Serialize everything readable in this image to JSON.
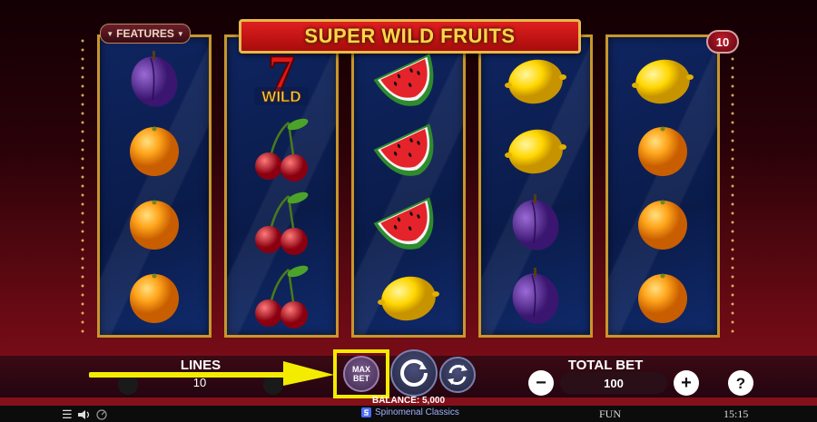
{
  "game": {
    "title": "SUPER WILD FRUITS",
    "features_label": "FEATURES",
    "lines_badge": "10"
  },
  "reels": [
    [
      "plum",
      "orange",
      "orange",
      "orange"
    ],
    [
      "wild-seven",
      "cherries",
      "cherries",
      "cherries"
    ],
    [
      "watermelon",
      "watermelon",
      "watermelon",
      "lemon"
    ],
    [
      "lemon",
      "lemon",
      "plum",
      "plum"
    ],
    [
      "lemon",
      "orange",
      "orange",
      "orange"
    ]
  ],
  "wild_text": "WILD",
  "controls": {
    "lines_label": "LINES",
    "lines_value": "10",
    "max_bet_line1": "MAX",
    "max_bet_line2": "BET",
    "total_bet_label": "TOTAL BET",
    "total_bet_value": "100",
    "minus": "−",
    "plus": "+",
    "help": "?",
    "balance": "BALANCE: 5,000"
  },
  "status_bar": {
    "brand": "Spinomenal Classics",
    "mode": "FUN",
    "clock": "15:15"
  },
  "colors": {
    "highlight": "#f4ec00",
    "reel_border": "#c8962c",
    "title_red": "#d01818"
  }
}
